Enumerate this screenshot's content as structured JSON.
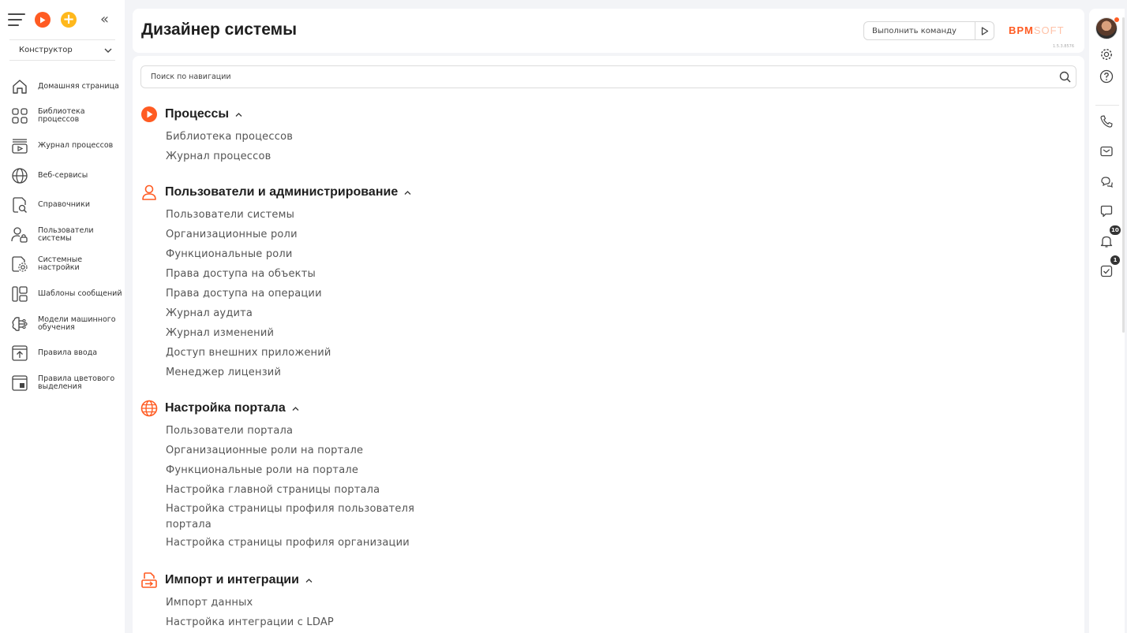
{
  "sidebar": {
    "workspace": "Конструктор",
    "items": [
      {
        "label": "Домашняя страница",
        "icon": "home-icon"
      },
      {
        "label": "Библиотека процессов",
        "icon": "process-library-icon"
      },
      {
        "label": "Журнал процессов",
        "icon": "process-log-icon"
      },
      {
        "label": "Веб-сервисы",
        "icon": "globe-icon"
      },
      {
        "label": "Справочники",
        "icon": "lookup-icon"
      },
      {
        "label": "Пользователи системы",
        "icon": "user-lock-icon"
      },
      {
        "label": "Системные настройки",
        "icon": "settings-doc-icon"
      },
      {
        "label": "Шаблоны сообщений",
        "icon": "template-icon"
      },
      {
        "label": "Модели машинного обучения",
        "icon": "brain-icon"
      },
      {
        "label": "Правила ввода",
        "icon": "upload-rule-icon"
      },
      {
        "label": "Правила цветового выделения",
        "icon": "color-rule-icon"
      }
    ]
  },
  "header": {
    "title": "Дизайнер системы",
    "command_placeholder": "Выполнить команду",
    "logo_strong": "BPM",
    "logo_light": "SOFT",
    "version": "1.5.3.8576"
  },
  "search": {
    "placeholder": "Поиск по навигации"
  },
  "sections": [
    {
      "title": "Процессы",
      "links": [
        "Библиотека процессов",
        "Журнал процессов"
      ]
    },
    {
      "title": "Пользователи и администрирование",
      "links": [
        "Пользователи системы",
        "Организационные роли",
        "Функциональные роли",
        "Права доступа на объекты",
        "Права доступа на операции",
        "Журнал аудита",
        "Журнал изменений",
        "Доступ внешних приложений",
        "Менеджер лицензий"
      ]
    },
    {
      "title": "Настройка портала",
      "links": [
        "Пользователи портала",
        "Организационные роли на портале",
        "Функциональные роли на портале",
        "Настройка главной страницы портала",
        "Настройка страницы профиля пользователя портала",
        "Настройка страницы профиля организации"
      ]
    },
    {
      "title": "Импорт и интеграции",
      "links": [
        "Импорт данных",
        "Настройка интеграции с LDAP"
      ]
    }
  ],
  "rail": {
    "notifications_count": "10",
    "tasks_count": "1"
  },
  "colors": {
    "accent": "#ff5b22",
    "yellow": "#ffb81c"
  }
}
